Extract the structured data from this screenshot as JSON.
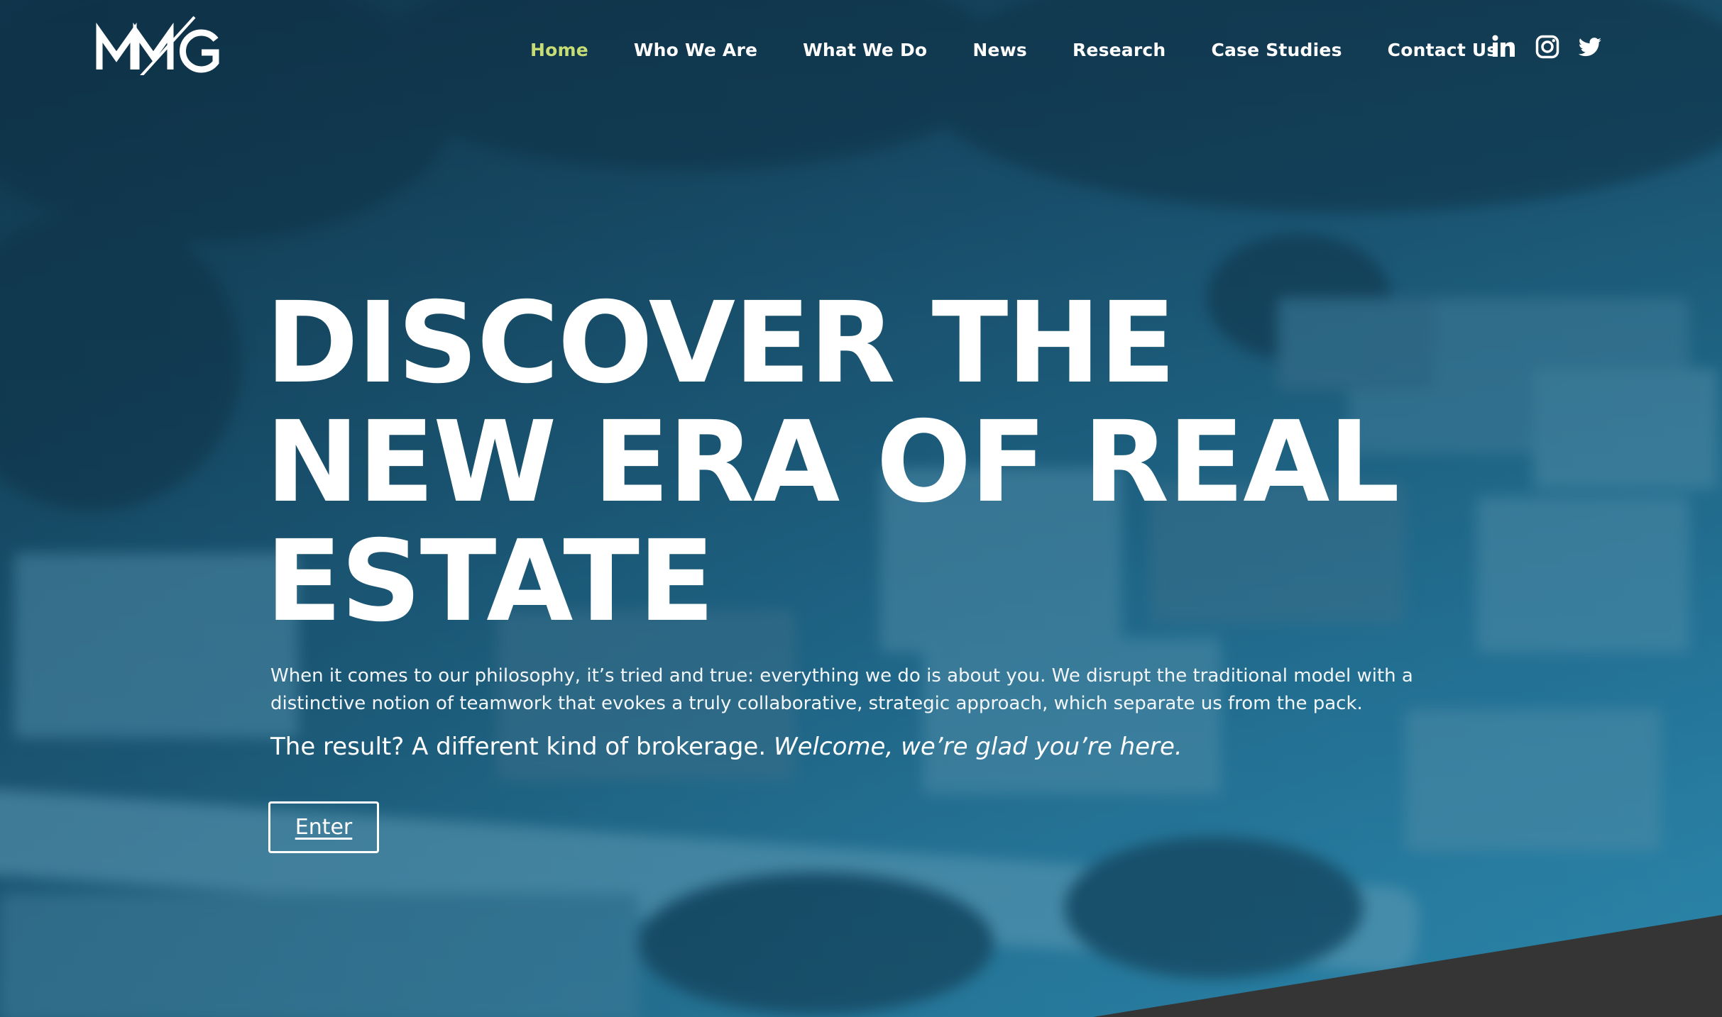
{
  "header": {
    "logo_text": "MMG",
    "nav": [
      {
        "label": "Home",
        "active": true
      },
      {
        "label": "Who We Are",
        "active": false
      },
      {
        "label": "What We Do",
        "active": false
      },
      {
        "label": "News",
        "active": false
      },
      {
        "label": "Research",
        "active": false
      },
      {
        "label": "Case Studies",
        "active": false
      },
      {
        "label": "Contact Us",
        "active": false
      }
    ],
    "social": [
      {
        "icon": "linkedin-icon"
      },
      {
        "icon": "instagram-icon"
      },
      {
        "icon": "twitter-icon"
      }
    ]
  },
  "hero": {
    "headline_lines": [
      "DISCOVER THE",
      "NEW ERA OF REAL",
      "ESTATE"
    ],
    "intro": "When it comes to our philosophy, it’s tried and true: everything we do is about you. We disrupt the traditional model with a distinctive notion of teamwork that evokes a truly collaborative, strategic approach, which separate us from the pack.",
    "result_plain": "The result? A different kind of brokerage.",
    "result_italic": "Welcome, we’re glad you’re here.",
    "enter_label": "Enter"
  },
  "colors": {
    "accent_active_nav": "#c6dc74",
    "overlay_blue": "#1d5a78",
    "footer_wedge": "#353535",
    "text": "#ffffff"
  }
}
